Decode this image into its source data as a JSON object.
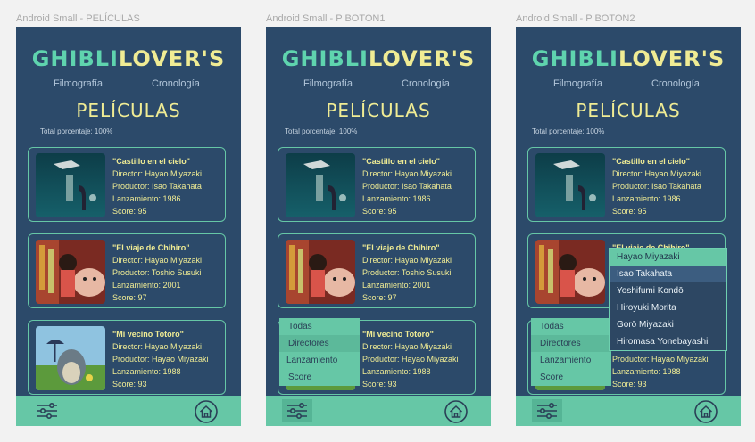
{
  "frames": [
    {
      "label": "Android Small - PELÍCULAS"
    },
    {
      "label": "Android Small - P BOTON1"
    },
    {
      "label": "Android Small - P BOTON2"
    }
  ],
  "app": {
    "title_part1": "GHIBLI",
    "title_part2": "LOVER'S",
    "nav_left": "Filmografía",
    "nav_right": "Cronología",
    "subtitle": "PELÍCULAS",
    "total": "Total porcentaje: 100%"
  },
  "movies": [
    {
      "title": "\"Castillo en el cielo\"",
      "director": "Director: Hayao Miyazaki",
      "producer": "Productor: Isao Takahata",
      "release": "Lanzamiento: 1986",
      "score": "Score: 95"
    },
    {
      "title": "\"El viaje de Chihiro\"",
      "director": "Director: Hayao Miyazaki",
      "producer": "Productor: Toshio Susuki",
      "release": "Lanzamiento: 2001",
      "score": "Score: 97"
    },
    {
      "title": "\"Mi vecino Totoro\"",
      "director": "Director: Hayao Miyazaki",
      "producer": "Productor: Hayao Miyazaki",
      "release": "Lanzamiento: 1988",
      "score": "Score: 93"
    }
  ],
  "filter_menu": [
    "Todas",
    "Directores",
    "Lanzamiento",
    "Score"
  ],
  "directors_menu": [
    "Hayao Miyazaki",
    "Isao Takahata",
    "Yoshifumi Kondō",
    "Hiroyuki Morita",
    "Gorō Miyazaki",
    "Hiromasa Yonebayashi"
  ],
  "icons": {
    "filter": "sliders-icon",
    "home": "home-icon"
  },
  "colors": {
    "background": "#2c4a6a",
    "accent_green": "#66c7a6",
    "title_yellow": "#f0ec94",
    "title_green": "#5fd4ae"
  }
}
